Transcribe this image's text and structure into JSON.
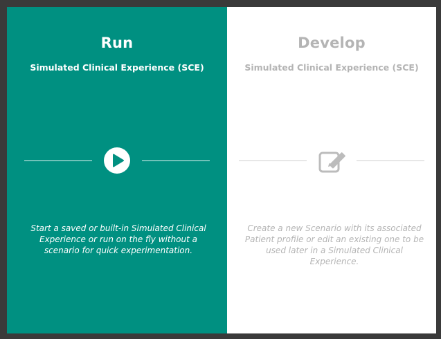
{
  "run": {
    "title": "Run",
    "subtitle": "Simulated Clinical Experience (SCE)",
    "icon": "play-icon",
    "description": "Start a saved or built-in Simulated Clinical Experience or run on the fly without a scenario for quick experimentation.",
    "background_color": "#009081",
    "text_color": "#ffffff"
  },
  "develop": {
    "title": "Develop",
    "subtitle": "Simulated Clinical Experience (SCE)",
    "icon": "edit-icon",
    "description": "Create a new Scenario with its associated Patient profile or edit an existing one to be used later in a Simulated Clinical Experience.",
    "background_color": "#ffffff",
    "text_color": "#b4b4b4"
  }
}
